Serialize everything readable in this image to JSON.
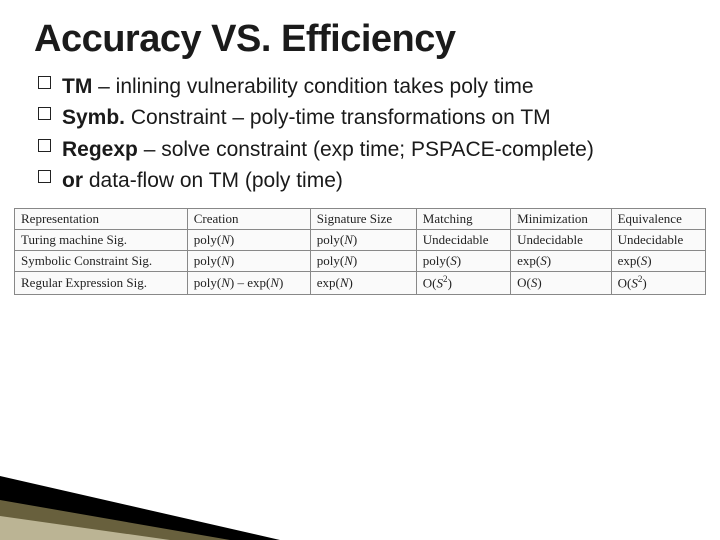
{
  "title": "Accuracy VS. Efficiency",
  "bullets": [
    {
      "lead": "TM",
      "rest": " – inlining vulnerability condition takes poly time"
    },
    {
      "lead": "Symb.",
      "rest": " Constraint – poly-time transformations on TM"
    },
    {
      "lead": "Regexp",
      "rest": " – solve constraint (exp time; PSPACE-complete)"
    },
    {
      "lead": "or",
      "rest": " data-flow on TM (poly time)"
    }
  ],
  "table": {
    "headers": [
      "Representation",
      "Creation",
      "Signature Size",
      "Matching",
      "Minimization",
      "Equivalence"
    ],
    "rows": [
      [
        "Turing machine Sig.",
        "poly(N)",
        "poly(N)",
        "Undecidable",
        "Undecidable",
        "Undecidable"
      ],
      [
        "Symbolic Constraint Sig.",
        "poly(N)",
        "poly(N)",
        "poly(S)",
        "exp(S)",
        "exp(S)"
      ],
      [
        "Regular Expression Sig.",
        "poly(N) – exp(N)",
        "exp(N)",
        "O(S²)",
        "O(S)",
        "O(S²)"
      ]
    ]
  },
  "chart_data": {
    "type": "table",
    "title": "Complexity comparison of signature representations",
    "columns": [
      "Representation",
      "Creation",
      "Signature Size",
      "Matching",
      "Minimization",
      "Equivalence"
    ],
    "rows": [
      {
        "Representation": "Turing machine Sig.",
        "Creation": "poly(N)",
        "Signature Size": "poly(N)",
        "Matching": "Undecidable",
        "Minimization": "Undecidable",
        "Equivalence": "Undecidable"
      },
      {
        "Representation": "Symbolic Constraint Sig.",
        "Creation": "poly(N)",
        "Signature Size": "poly(N)",
        "Matching": "poly(S)",
        "Minimization": "exp(S)",
        "Equivalence": "exp(S)"
      },
      {
        "Representation": "Regular Expression Sig.",
        "Creation": "poly(N) – exp(N)",
        "Signature Size": "exp(N)",
        "Matching": "O(S²)",
        "Minimization": "O(S)",
        "Equivalence": "O(S²)"
      }
    ]
  }
}
